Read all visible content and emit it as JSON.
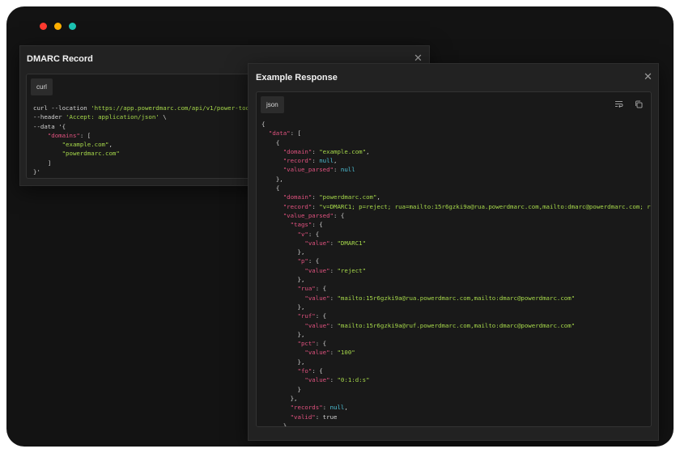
{
  "window_controls": {
    "close_color": "#ff3b30",
    "minimize_color": "#ffb000",
    "maximize_color": "#1cc3b2"
  },
  "colors": {
    "key": "#e0527f",
    "string": "#a6d84a",
    "literal": "#4ec2d8",
    "text": "#d2d2d2"
  },
  "dmarc_panel": {
    "title": "DMARC Record",
    "close_icon": "close-icon",
    "lang_tab": "curl",
    "code": [
      "curl --location ",
      "'https://app.powerdmarc.com/api/v1/power-too",
      "--header ",
      "'Accept: application/json'",
      " \\",
      "--data '{",
      "\"domains\"",
      ": [",
      "\"example.com\"",
      ",",
      "\"powerdmarc.com\"",
      "]",
      "}'"
    ]
  },
  "response_panel": {
    "title": "Example Response",
    "close_icon": "close-icon",
    "lang_tab": "json",
    "wrap_icon": "wrap-lines-icon",
    "copy_icon": "copy-icon",
    "code": [
      "{",
      "\"data\"",
      ": [",
      "{",
      "\"domain\"",
      ": ",
      "\"example.com\"",
      ",",
      "\"record\"",
      ": ",
      "null",
      ",",
      "\"value_parsed\"",
      ": ",
      "null",
      "},",
      "{",
      "\"domain\"",
      ": ",
      "\"powerdmarc.com\"",
      ",",
      "\"record\"",
      ": ",
      "\"v=DMARC1; p=reject; rua=mailto:15r6gzki9a@rua.powerdmarc.com,mailto:dmarc@powerdmarc.com; ru",
      "\"value_parsed\"",
      ": {",
      "\"tags\"",
      ": {",
      "\"v\"",
      ": {",
      "\"value\"",
      ": ",
      "\"DMARC1\"",
      "},",
      "\"p\"",
      ": {",
      "\"value\"",
      ": ",
      "\"reject\"",
      "},",
      "\"rua\"",
      ": {",
      "\"value\"",
      ": ",
      "\"mailto:15r6gzki9a@rua.powerdmarc.com,mailto:dmarc@powerdmarc.com\"",
      "},",
      "\"ruf\"",
      ": {",
      "\"value\"",
      ": ",
      "\"mailto:15r6gzki9a@ruf.powerdmarc.com,mailto:dmarc@powerdmarc.com\"",
      "},",
      "\"pct\"",
      ": {",
      "\"value\"",
      ": ",
      "\"100\"",
      "},",
      "\"fo\"",
      ": {",
      "\"value\"",
      ": ",
      "\"0:1:d:s\"",
      "}",
      "},",
      "\"records\"",
      ": ",
      "null",
      ",",
      "\"valid\"",
      ": ",
      "true",
      "}"
    ]
  }
}
